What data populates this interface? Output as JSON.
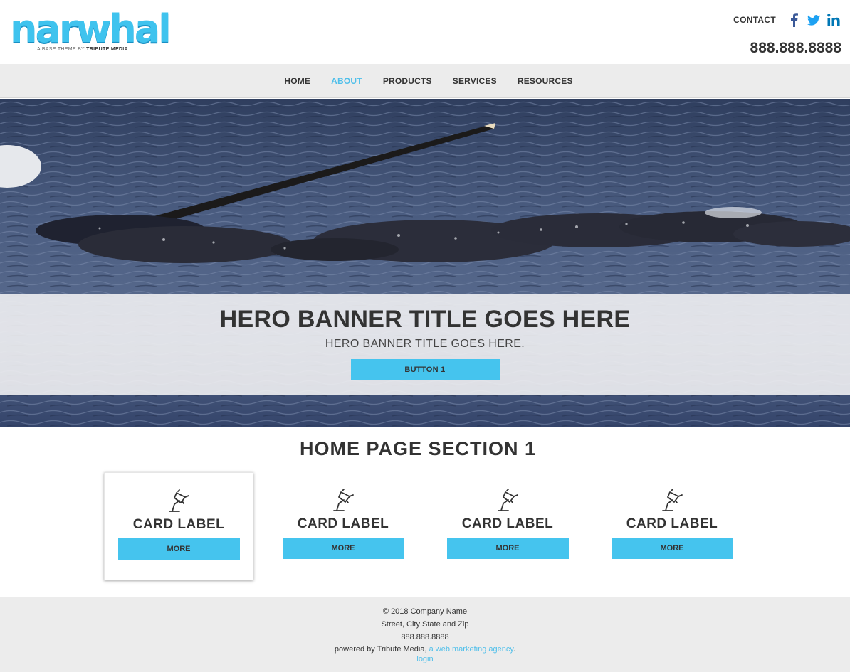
{
  "header": {
    "logo_text": "narwhal",
    "logo_tagline_prefix": "A BASE THEME BY",
    "logo_tagline_brand": "TRIBUTE MEDIA",
    "contact_label": "CONTACT",
    "phone": "888.888.8888",
    "social": [
      {
        "icon": "facebook-icon",
        "color": "#3b5998"
      },
      {
        "icon": "twitter-icon",
        "color": "#1da1f2"
      },
      {
        "icon": "linkedin-icon",
        "color": "#0077b5"
      }
    ]
  },
  "nav": {
    "items": [
      {
        "label": "HOME",
        "active": false
      },
      {
        "label": "ABOUT",
        "active": true
      },
      {
        "label": "PRODUCTS",
        "active": false
      },
      {
        "label": "SERVICES",
        "active": false
      },
      {
        "label": "RESOURCES",
        "active": false
      }
    ]
  },
  "hero": {
    "title": "HERO BANNER TITLE GOES HERE",
    "subtitle": "HERO BANNER TITLE GOES HERE.",
    "button_label": "BUTTON 1"
  },
  "section": {
    "title": "HOME PAGE SECTION 1",
    "cards": [
      {
        "icon": "desk-lamp-icon",
        "label": "CARD LABEL",
        "button": "MORE"
      },
      {
        "icon": "desk-lamp-icon",
        "label": "CARD LABEL",
        "button": "MORE"
      },
      {
        "icon": "desk-lamp-icon",
        "label": "CARD LABEL",
        "button": "MORE"
      },
      {
        "icon": "desk-lamp-icon",
        "label": "CARD LABEL",
        "button": "MORE"
      }
    ]
  },
  "footer": {
    "copyright": "© 2018 Company Name",
    "address": "Street, City State and Zip",
    "phone": "888.888.8888",
    "powered_prefix": "powered by Tribute Media,",
    "powered_link": "a web marketing agency",
    "powered_suffix": ".",
    "login": "login"
  },
  "colors": {
    "accent": "#45c4ee",
    "nav_active": "#4fbfea",
    "nav_bg": "#ececec",
    "footer_bg": "#ececec",
    "text": "#333333"
  }
}
